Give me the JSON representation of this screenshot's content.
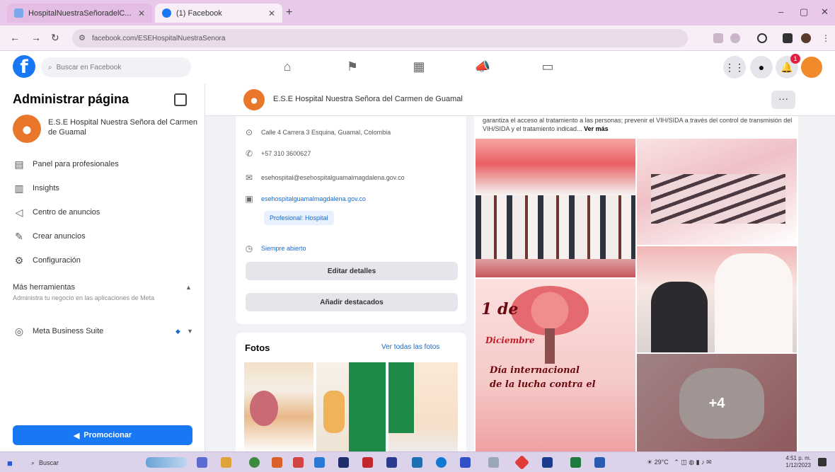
{
  "browser": {
    "tabs": [
      {
        "title": "HospitalNuestraSeñoradelC...",
        "active": false
      },
      {
        "title": "(1) Facebook",
        "active": true
      }
    ],
    "url": "facebook.com/ESEHospitalNuestraSenora",
    "new_tab": "+",
    "minimize": "–",
    "maximize": "▢",
    "close": "✕"
  },
  "fb_header": {
    "logo": "f",
    "search_placeholder": "Buscar en Facebook",
    "notification_count": "1"
  },
  "sidebar": {
    "title": "Administrar página",
    "page_name": "E.S.E Hospital Nuestra Señora del Carmen de Guamal",
    "items": [
      {
        "label": "Panel para profesionales",
        "icon": "dashboard-icon"
      },
      {
        "label": "Insights",
        "icon": "insights-icon"
      },
      {
        "label": "Centro de anuncios",
        "icon": "megaphone-icon"
      },
      {
        "label": "Crear anuncios",
        "icon": "edit-icon"
      },
      {
        "label": "Configuración",
        "icon": "gear-icon"
      }
    ],
    "more_tools_title": "Más herramientas",
    "more_tools_subtitle": "Administra tu negocio en las aplicaciones de Meta",
    "meta_suite": "Meta Business Suite",
    "promote_label": "Promocionar"
  },
  "page_header": {
    "name": "E.S.E Hospital Nuestra Señora del Carmen de Guamal",
    "more": "···"
  },
  "intro": {
    "address": "Calle 4 Carrera 3 Esquina, Guamal, Colombia",
    "phone": "+57 310 3600627",
    "email_1": "esehospital@esehospitalguamalmagdalena.gov.co",
    "email_2": "esehospitalguamalmagdalena.gov.co",
    "tag": "Profesional: Hospital",
    "hours": "Siempre abierto",
    "edit_details": "Editar detalles",
    "add_featured": "Añadir destacados"
  },
  "photos": {
    "title": "Fotos",
    "see_all": "Ver todas las fotos"
  },
  "post": {
    "text": "garantiza el acceso al tratamiento a las personas; prevenir el VIH/SIDA a través del control de transmisión del VIH/SIDA y el tratamiento indicad...",
    "see_more": "Ver más",
    "poster_line_1": "1 de",
    "poster_line_2": "Diciembre",
    "poster_line_3": "Día internacional",
    "poster_line_4": "de la lucha contra el",
    "extra_count": "+4"
  },
  "taskbar": {
    "search": "Buscar",
    "weather": "29°C",
    "time": "4:51 p. m.",
    "date": "1/12/2023"
  }
}
